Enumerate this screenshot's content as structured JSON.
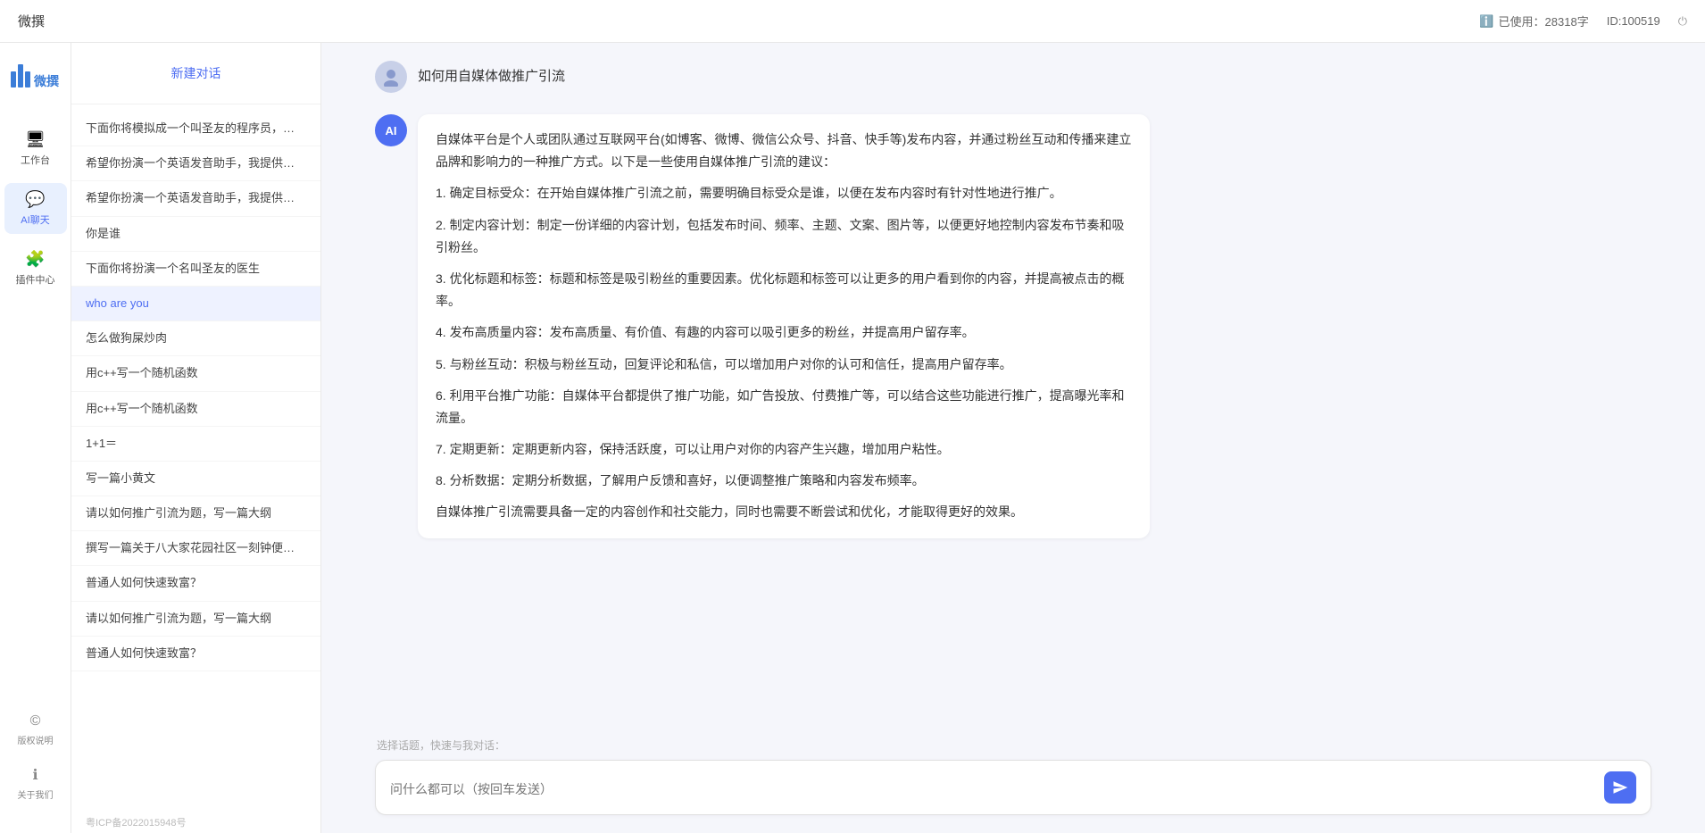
{
  "topbar": {
    "title": "微撰",
    "usage_label": "已使用：28318字",
    "id_label": "ID:100519",
    "usage_icon": "ℹ",
    "power_icon": "⏻"
  },
  "logo": {
    "text": "W 微撰"
  },
  "nav": {
    "items": [
      {
        "id": "workbench",
        "icon": "🖥",
        "label": "工作台"
      },
      {
        "id": "ai-chat",
        "icon": "💬",
        "label": "AI聊天",
        "active": true
      },
      {
        "id": "plugin",
        "icon": "🧩",
        "label": "插件中心"
      }
    ],
    "bottom_items": [
      {
        "id": "copyright",
        "icon": "©",
        "label": "版权说明"
      },
      {
        "id": "about",
        "icon": "ℹ",
        "label": "关于我们"
      }
    ]
  },
  "sidebar": {
    "new_chat_label": "新建对话",
    "items": [
      {
        "id": "chat1",
        "text": "下面你将模拟成一个叫圣友的程序员，我说..."
      },
      {
        "id": "chat2",
        "text": "希望你扮演一个英语发音助手，我提供给你..."
      },
      {
        "id": "chat3",
        "text": "希望你扮演一个英语发音助手，我提供给你..."
      },
      {
        "id": "chat4",
        "text": "你是谁"
      },
      {
        "id": "chat5",
        "text": "下面你将扮演一个名叫圣友的医生"
      },
      {
        "id": "chat6",
        "text": "who are you",
        "active": true
      },
      {
        "id": "chat7",
        "text": "怎么做狗屎炒肉"
      },
      {
        "id": "chat8",
        "text": "用c++写一个随机函数"
      },
      {
        "id": "chat9",
        "text": "用c++写一个随机函数"
      },
      {
        "id": "chat10",
        "text": "1+1＝"
      },
      {
        "id": "chat11",
        "text": "写一篇小黄文"
      },
      {
        "id": "chat12",
        "text": "请以如何推广引流为题，写一篇大纲"
      },
      {
        "id": "chat13",
        "text": "撰写一篇关于八大家花园社区一刻钟便民生..."
      },
      {
        "id": "chat14",
        "text": "普通人如何快速致富？"
      },
      {
        "id": "chat15",
        "text": "请以如何推广引流为题，写一篇大纲"
      },
      {
        "id": "chat16",
        "text": "普通人如何快速致富？"
      }
    ]
  },
  "chat": {
    "user_message": "如何用自媒体做推广引流",
    "ai_response": {
      "paragraphs": [
        "自媒体平台是个人或团队通过互联网平台(如博客、微博、微信公众号、抖音、快手等)发布内容，并通过粉丝互动和传播来建立品牌和影响力的一种推广方式。以下是一些使用自媒体推广引流的建议：",
        "1. 确定目标受众：在开始自媒体推广引流之前，需要明确目标受众是谁，以便在发布内容时有针对性地进行推广。",
        "2. 制定内容计划：制定一份详细的内容计划，包括发布时间、频率、主题、文案、图片等，以便更好地控制内容发布节奏和吸引粉丝。",
        "3. 优化标题和标签：标题和标签是吸引粉丝的重要因素。优化标题和标签可以让更多的用户看到你的内容，并提高被点击的概率。",
        "4. 发布高质量内容：发布高质量、有价值、有趣的内容可以吸引更多的粉丝，并提高用户留存率。",
        "5. 与粉丝互动：积极与粉丝互动，回复评论和私信，可以增加用户对你的认可和信任，提高用户留存率。",
        "6. 利用平台推广功能：自媒体平台都提供了推广功能，如广告投放、付费推广等，可以结合这些功能进行推广，提高曝光率和流量。",
        "7. 定期更新：定期更新内容，保持活跃度，可以让用户对你的内容产生兴趣，增加用户粘性。",
        "8. 分析数据：定期分析数据，了解用户反馈和喜好，以便调整推广策略和内容发布频率。",
        "自媒体推广引流需要具备一定的内容创作和社交能力，同时也需要不断尝试和优化，才能取得更好的效果。"
      ]
    },
    "input_placeholder": "问什么都可以（按回车发送）",
    "quick_hint": "选择话题，快速与我对话："
  },
  "icp": {
    "text": "粤ICP备2022015948号"
  }
}
